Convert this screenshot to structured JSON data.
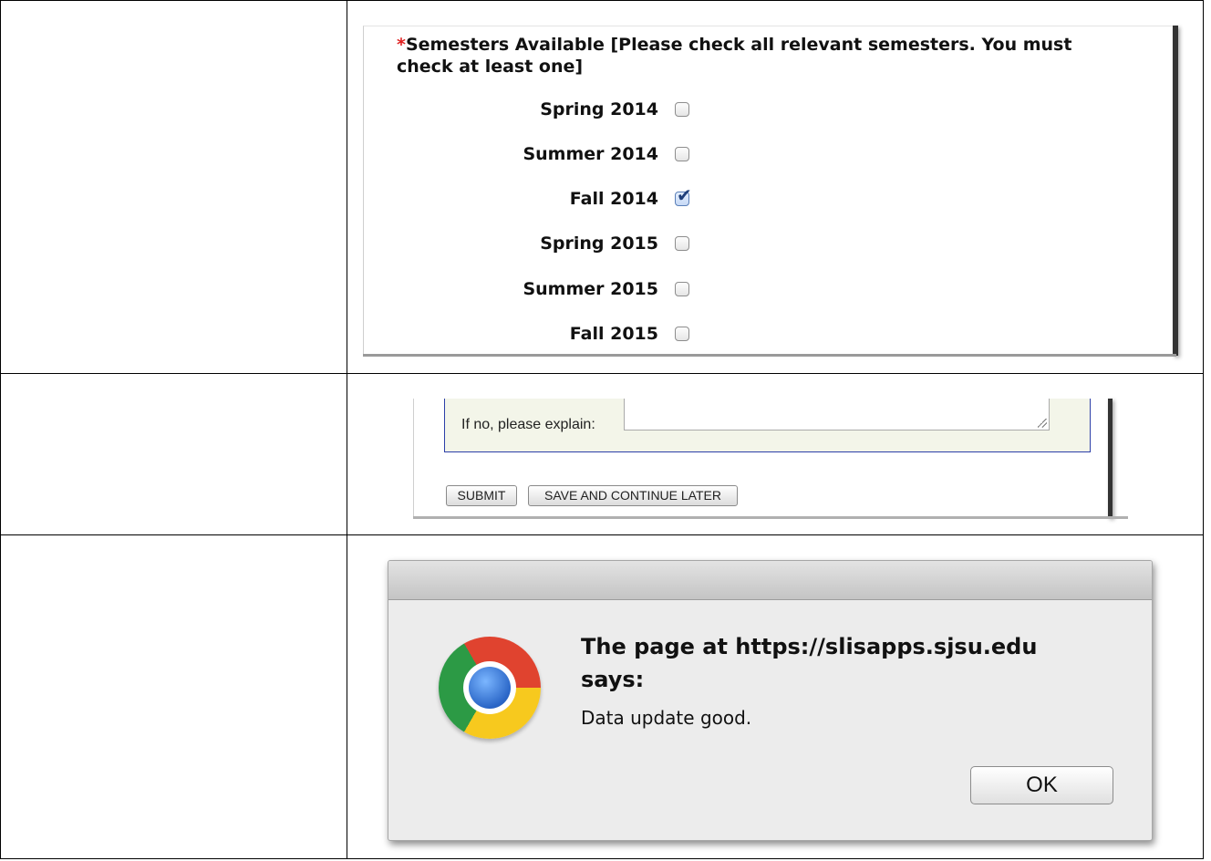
{
  "semesters": {
    "required_marker": "*",
    "question": "Semesters Available [Please check all relevant semesters. You must check at least one]",
    "options": [
      {
        "label": "Spring 2014",
        "checked": false
      },
      {
        "label": "Summer 2014",
        "checked": false
      },
      {
        "label": "Fall 2014",
        "checked": true
      },
      {
        "label": "Spring 2015",
        "checked": false
      },
      {
        "label": "Summer 2015",
        "checked": false
      },
      {
        "label": "Fall 2015",
        "checked": false
      }
    ]
  },
  "form": {
    "explain_label": "If no, please explain:",
    "explain_value": "",
    "submit_label": "SUBMIT",
    "save_label": "SAVE AND CONTINUE LATER"
  },
  "dialog": {
    "heading": "The page at https://slisapps.sjsu.edu says:",
    "message": "Data update good.",
    "ok_label": "OK"
  },
  "icons": {
    "browser_logo": "chrome-logo-icon",
    "check_mark": "checkmark-icon"
  },
  "colors": {
    "required": "#e02020",
    "field_background": "#f3f5e9",
    "field_border": "#2c3fa8"
  }
}
